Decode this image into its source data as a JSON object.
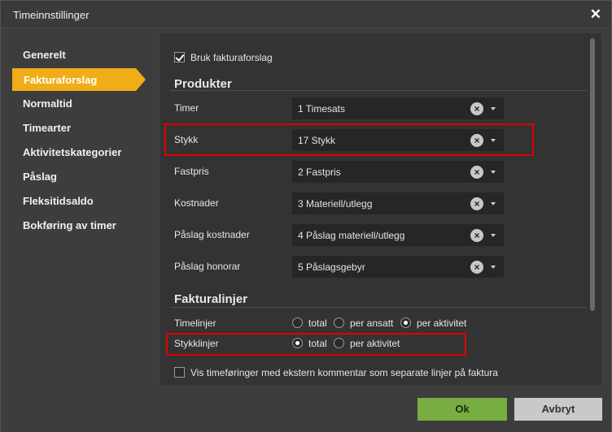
{
  "dialog": {
    "title": "Timeinnstillinger"
  },
  "sidebar": {
    "items": [
      {
        "label": "Generelt"
      },
      {
        "label": "Fakturaforslag"
      },
      {
        "label": "Normaltid"
      },
      {
        "label": "Timearter"
      },
      {
        "label": "Aktivitetskategorier"
      },
      {
        "label": "Påslag"
      },
      {
        "label": "Fleksitidsaldo"
      },
      {
        "label": "Bokføring av timer"
      }
    ],
    "active_index": 1
  },
  "main": {
    "use_suggestion": {
      "label": "Bruk fakturaforslag",
      "checked": true
    },
    "products": {
      "heading": "Produkter",
      "rows": [
        {
          "label": "Timer",
          "value": "1 Timesats"
        },
        {
          "label": "Stykk",
          "value": "17 Stykk"
        },
        {
          "label": "Fastpris",
          "value": "2 Fastpris"
        },
        {
          "label": "Kostnader",
          "value": "3 Materiell/utlegg"
        },
        {
          "label": "Påslag kostnader",
          "value": "4 Påslag materiell/utlegg"
        },
        {
          "label": "Påslag honorar",
          "value": "5 Påslagsgebyr"
        }
      ]
    },
    "invoice_lines": {
      "heading": "Fakturalinjer",
      "timelinjer": {
        "label": "Timelinjer",
        "options": [
          "total",
          "per ansatt",
          "per aktivitet"
        ],
        "selected": "per aktivitet"
      },
      "stykklinjer": {
        "label": "Stykklinjer",
        "options": [
          "total",
          "per aktivitet"
        ],
        "selected": "total"
      },
      "external_comment": {
        "label": "Vis timeføringer med ekstern kommentar som separate linjer på faktura",
        "checked": false
      }
    }
  },
  "footer": {
    "ok_label": "Ok",
    "cancel_label": "Avbryt"
  },
  "colors": {
    "accent": "#f0ad17",
    "ok": "#78ad42",
    "highlight": "#e00000"
  }
}
